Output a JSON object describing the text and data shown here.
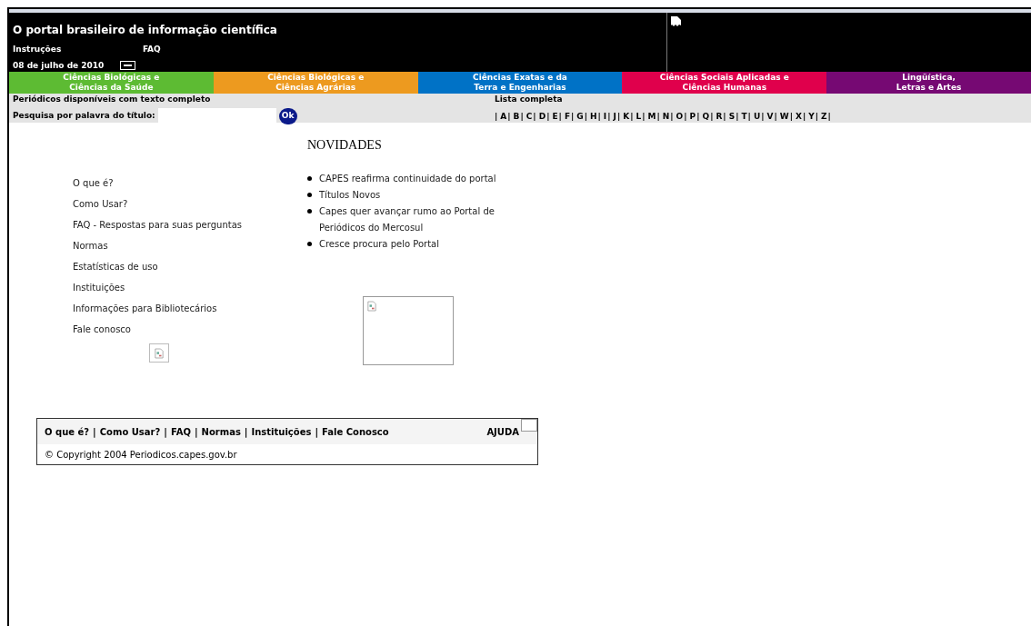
{
  "header": {
    "title": "O portal brasileiro de informação científica",
    "links": [
      "Instruções",
      "FAQ"
    ],
    "date": "08 de julho de 2010"
  },
  "areas": [
    {
      "label": "Ciências Biológicas e\nCiências da Saúde",
      "color": "#5dbb33"
    },
    {
      "label": "Ciências Biológicas e\nCiências Agrárias",
      "color": "#ed9a1f"
    },
    {
      "label": "Ciências Exatas e da\nTerra e Engenharias",
      "color": "#0072c6"
    },
    {
      "label": "Ciências Sociais Aplicadas e\nCiências Humanas",
      "color": "#e0004c"
    },
    {
      "label": "Lingüística,\nLetras e Artes",
      "color": "#760973"
    }
  ],
  "search": {
    "heading": "Periódicos disponíveis com texto completo",
    "label": "Pesquisa por palavra do título:",
    "button": "Ok",
    "list_heading": "Lista completa",
    "separator": "|",
    "letters": [
      "A",
      "B",
      "C",
      "D",
      "E",
      "F",
      "G",
      "H",
      "I",
      "J",
      "K",
      "L",
      "M",
      "N",
      "O",
      "P",
      "Q",
      "R",
      "S",
      "T",
      "U",
      "V",
      "W",
      "X",
      "Y",
      "Z"
    ]
  },
  "menu": [
    "O que é?",
    "Como Usar?",
    "FAQ - Respostas para suas perguntas",
    "Normas",
    "Estatísticas de uso",
    "Instituições",
    "Informações para Bibliotecários",
    "Fale conosco"
  ],
  "news": {
    "title": "NOVIDADES",
    "items": [
      "CAPES reafirma continuidade do portal",
      "Títulos Novos",
      "Capes quer avançar rumo ao Portal de Periódicos do Mercosul",
      "Cresce procura pelo Portal"
    ]
  },
  "footer": {
    "links": [
      "O que é?",
      "Como Usar?",
      "FAQ",
      "Normas",
      "Instituições",
      "Fale Conosco"
    ],
    "separator": "|",
    "help": "AJUDA",
    "copyright": "© Copyright 2004 Periodicos.capes.gov.br"
  }
}
